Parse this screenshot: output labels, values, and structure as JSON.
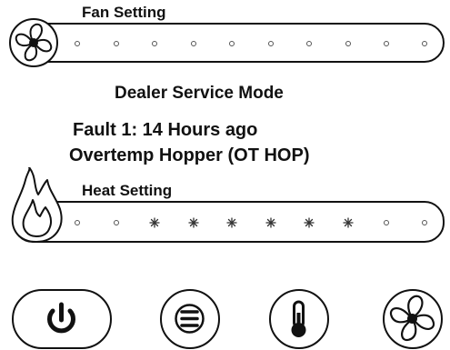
{
  "fan_setting": {
    "label": "Fan Setting",
    "icon": "fan-icon",
    "level": 0,
    "steps": 10
  },
  "mode_title": "Dealer Service Mode",
  "fault": {
    "line1": "Fault 1:  14 Hours ago",
    "line2": "Overtemp Hopper (OT HOP)"
  },
  "heat_setting": {
    "label": "Heat Setting",
    "icon": "flame-icon",
    "steps": [
      "dot",
      "dot",
      "star",
      "star",
      "star",
      "star",
      "star",
      "star",
      "dot",
      "dot"
    ]
  },
  "buttons": [
    {
      "name": "power-button",
      "icon": "power-icon"
    },
    {
      "name": "menu-button",
      "icon": "hamburger-menu-icon"
    },
    {
      "name": "temperature-button",
      "icon": "thermometer-icon"
    },
    {
      "name": "fan-button",
      "icon": "fan-icon"
    }
  ],
  "colors": {
    "foreground": "#111111",
    "background": "#ffffff"
  }
}
